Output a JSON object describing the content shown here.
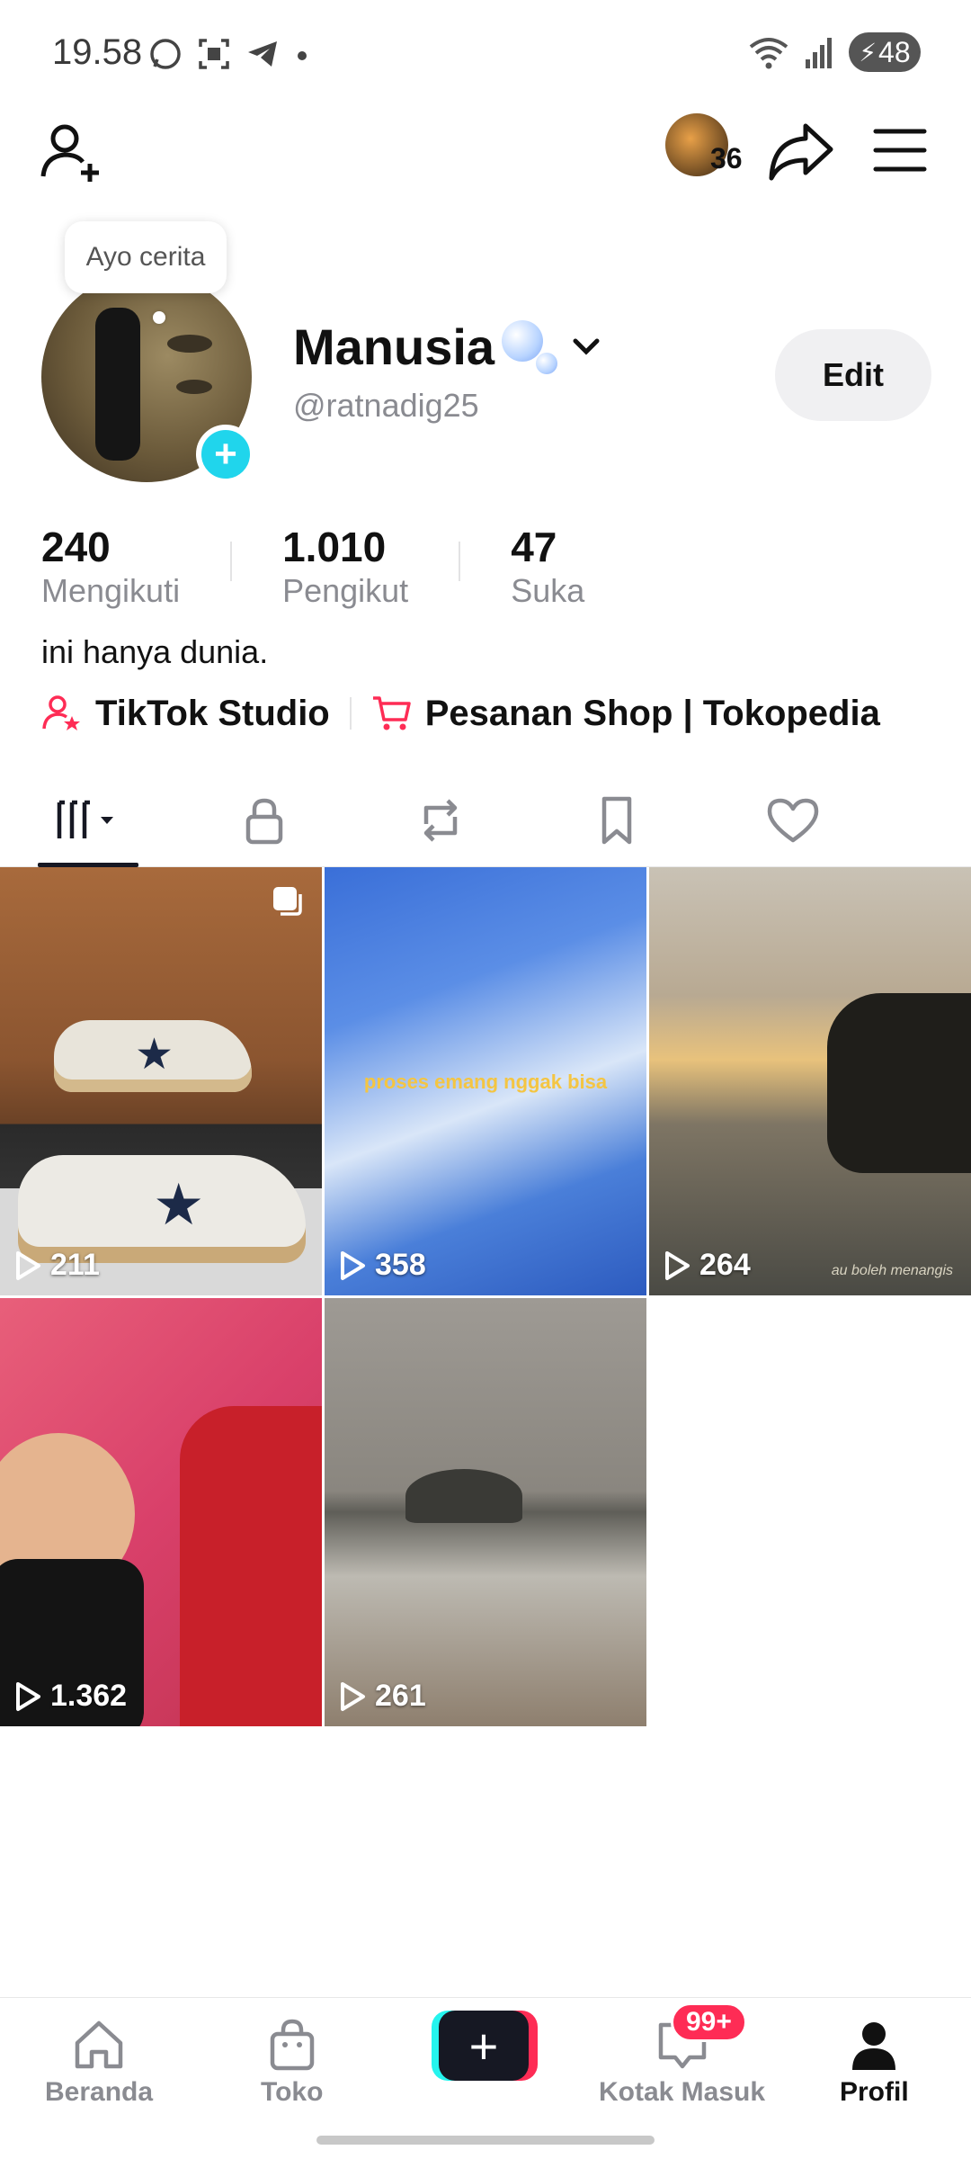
{
  "status_bar": {
    "time": "19.58",
    "battery": "48"
  },
  "topbar": {
    "avatar_count": "36"
  },
  "profile": {
    "tooltip": "Ayo cerita",
    "display_name": "Manusia",
    "username": "@ratnadig25",
    "edit_label": "Edit",
    "bio": "ini hanya dunia."
  },
  "stats": [
    {
      "value": "240",
      "label": "Mengikuti"
    },
    {
      "value": "1.010",
      "label": "Pengikut"
    },
    {
      "value": "47",
      "label": "Suka"
    }
  ],
  "links": [
    {
      "label": "TikTok Studio",
      "icon": "person-star-icon"
    },
    {
      "label": "Pesanan Shop | Tokopedia",
      "icon": "cart-icon"
    }
  ],
  "tabs": [
    {
      "name": "videos",
      "icon": "grid-icon",
      "active": true
    },
    {
      "name": "private",
      "icon": "lock-icon",
      "active": false
    },
    {
      "name": "reposts",
      "icon": "repost-icon",
      "active": false
    },
    {
      "name": "favorites",
      "icon": "bookmark-icon",
      "active": false
    },
    {
      "name": "liked",
      "icon": "heart-icon",
      "active": false
    }
  ],
  "videos": [
    {
      "views": "211",
      "caption": ""
    },
    {
      "views": "358",
      "caption": "proses emang nggak bisa"
    },
    {
      "views": "264",
      "caption": "au boleh menangis"
    },
    {
      "views": "1.362",
      "caption": ""
    },
    {
      "views": "261",
      "caption": ""
    }
  ],
  "bottom_nav": {
    "home": "Beranda",
    "shop": "Toko",
    "inbox": "Kotak Masuk",
    "inbox_badge": "99+",
    "profile": "Profil"
  },
  "colors": {
    "accent": "#fe2c55",
    "cyan": "#25f4ee",
    "badge_plus": "#20d5ec"
  }
}
